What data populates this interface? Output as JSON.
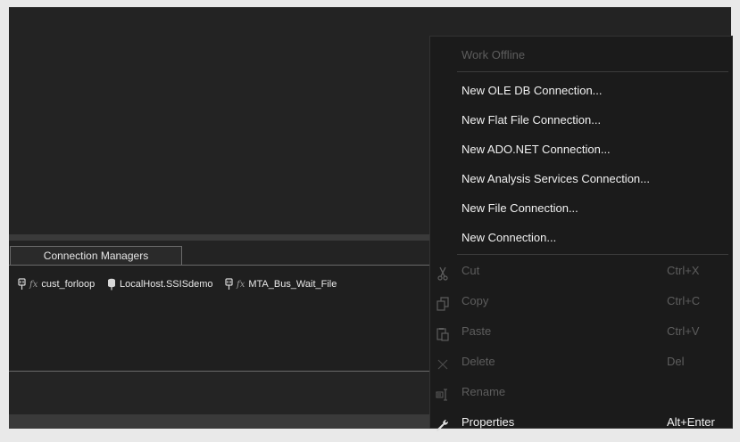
{
  "connection_managers": {
    "tab_label": "Connection Managers",
    "items": [
      {
        "label": "cust_forloop",
        "fx": "fx",
        "icon": "connection-plug-icon"
      },
      {
        "label": "LocalHost.SSISdemo",
        "fx": "",
        "icon": "database-connection-icon"
      },
      {
        "label": "MTA_Bus_Wait_File",
        "fx": "fx",
        "icon": "connection-plug-icon"
      }
    ]
  },
  "context_menu": {
    "work_offline": "Work Offline",
    "new_oledb": "New OLE DB Connection...",
    "new_flat_file": "New Flat File Connection...",
    "new_adonet": "New ADO.NET Connection...",
    "new_analysis": "New Analysis Services Connection...",
    "new_file": "New File Connection...",
    "new_connection": "New Connection...",
    "cut": {
      "label": "Cut",
      "shortcut": "Ctrl+X",
      "icon": "scissors-icon"
    },
    "copy": {
      "label": "Copy",
      "shortcut": "Ctrl+C",
      "icon": "copy-icon"
    },
    "paste": {
      "label": "Paste",
      "shortcut": "Ctrl+V",
      "icon": "paste-icon"
    },
    "delete": {
      "label": "Delete",
      "shortcut": "Del",
      "icon": "delete-x-icon"
    },
    "rename": {
      "label": "Rename",
      "icon": "rename-icon"
    },
    "properties": {
      "label": "Properties",
      "shortcut": "Alt+Enter",
      "icon": "wrench-icon"
    }
  },
  "colors": {
    "background": "#232323",
    "menu_background": "#1b1b1b",
    "menu_text": "#f1f1f1",
    "menu_disabled_text": "#5d5d5d"
  }
}
